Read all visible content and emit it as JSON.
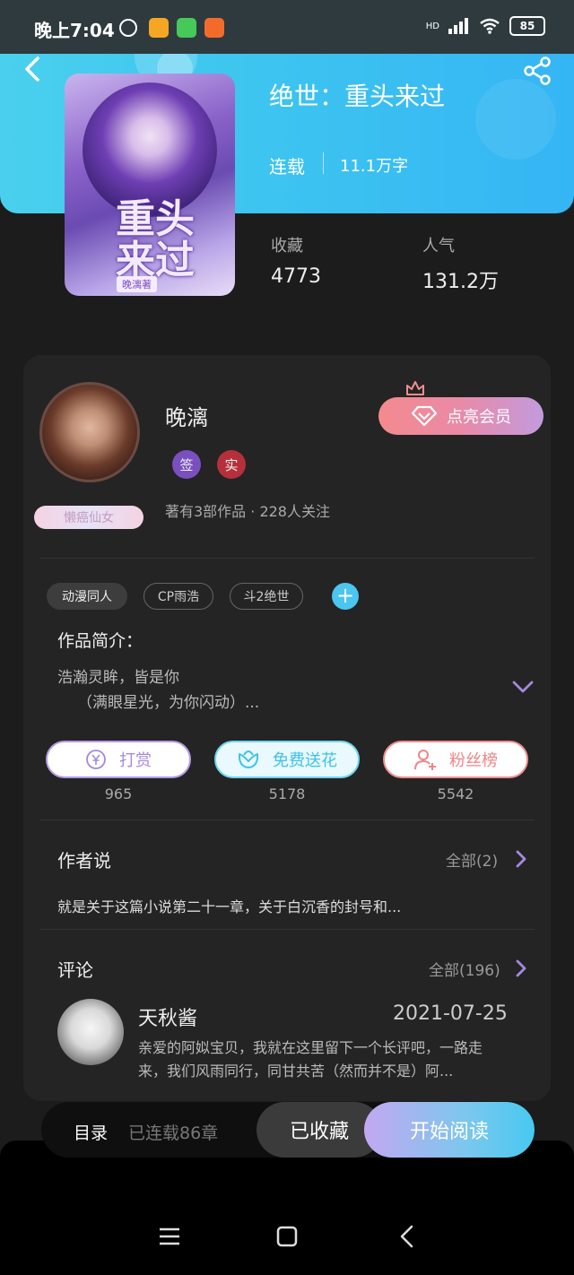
{
  "status_bar": {
    "time": "晚上7:04",
    "network": "HD",
    "battery": "85"
  },
  "book": {
    "title": "绝世：重头来过",
    "status": "连载",
    "word_count": "11.1万字",
    "cover_art_text": "重头来过",
    "cover_author_tag": "晚漓著"
  },
  "stats": [
    {
      "label": "收藏",
      "value": "4773"
    },
    {
      "label": "人气",
      "value": "131.2万"
    }
  ],
  "author": {
    "name": "晚漓",
    "badge": "懒癌仙女",
    "tags": [
      "签",
      "实"
    ],
    "meta": "著有3部作品 · 228人关注",
    "vip_label": "点亮会员"
  },
  "chips": [
    "动漫同人",
    "CP雨浩",
    "斗2绝世"
  ],
  "intro": {
    "title": "作品简介：",
    "line1": "浩瀚灵眸，皆是你",
    "line2": "（满眼星光，为你闪动）..."
  },
  "actions": [
    {
      "label": "打赏",
      "count": "965",
      "color": "#a688de"
    },
    {
      "label": "免费送花",
      "count": "5178",
      "color": "#3ec2e8"
    },
    {
      "label": "粉丝榜",
      "count": "5542",
      "color": "#ee8587"
    }
  ],
  "author_say": {
    "title": "作者说",
    "more": "全部(2)",
    "text": "就是关于这篇小说第二十一章，关于白沉香的封号和..."
  },
  "comments": {
    "title": "评论",
    "more": "全部(196)",
    "item": {
      "user": "天秋酱",
      "date": "2021-07-25",
      "text": "亲爱的阿姒宝贝，我就在这里留下一个长评吧，一路走来，我们风雨同行，同甘共苦（然而并不是）阿..."
    }
  },
  "bottom_bar": {
    "catalog": "目录",
    "chapters": "已连载86章",
    "saved": "已收藏",
    "read": "开始阅读"
  },
  "icons": [
    "back-icon",
    "share-icon",
    "crown-icon",
    "diamond-icon",
    "yen-icon",
    "flower-icon",
    "fans-icon",
    "chevron-down-icon",
    "chevron-right-icon",
    "menu-icon",
    "home-icon",
    "back-nav-icon"
  ]
}
